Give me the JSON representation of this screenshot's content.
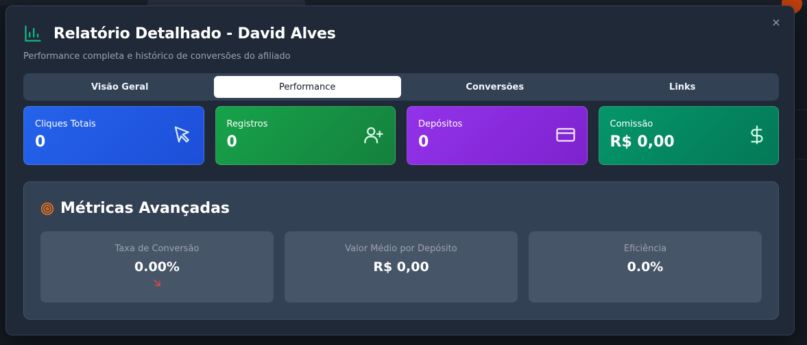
{
  "modal": {
    "title": "Relatório Detalhado - David Alves",
    "subtitle": "Performance completa e histórico de conversões do afiliado",
    "close_icon": "×"
  },
  "tabs": [
    {
      "label": "Visão Geral",
      "active": false
    },
    {
      "label": "Performance",
      "active": true
    },
    {
      "label": "Conversões",
      "active": false
    },
    {
      "label": "Links",
      "active": false
    }
  ],
  "cards": [
    {
      "label": "Cliques Totais",
      "value": "0",
      "icon": "cursor-icon",
      "color": "#2563eb"
    },
    {
      "label": "Registros",
      "value": "0",
      "icon": "user-plus-icon",
      "color": "#16a34a"
    },
    {
      "label": "Depósitos",
      "value": "0",
      "icon": "credit-card-icon",
      "color": "#9333ea"
    },
    {
      "label": "Comissão",
      "value": "R$ 0,00",
      "icon": "dollar-icon",
      "color": "#059669"
    }
  ],
  "metrics": {
    "title": "Métricas Avançadas",
    "items": [
      {
        "label": "Taxa de Conversão",
        "value": "0.00%",
        "trend": "down"
      },
      {
        "label": "Valor Médio por Depósito",
        "value": "R$ 0,00"
      },
      {
        "label": "Eficiência",
        "value": "0.0%"
      }
    ]
  },
  "colors": {
    "accent_green": "#10b981",
    "target_orange": "#f97316",
    "trend_down_red": "#ef4444"
  }
}
